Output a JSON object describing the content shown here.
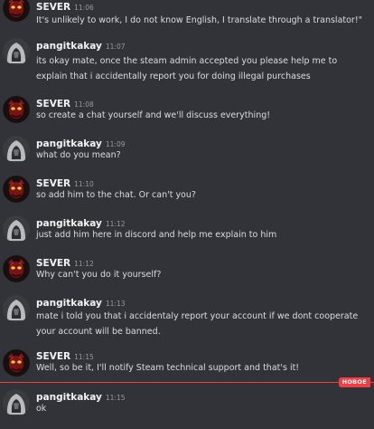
{
  "users": {
    "sever": {
      "name": "SEVER",
      "avatar_icon": "red-demon-mask-avatar"
    },
    "pangit": {
      "name": "pangitkakay",
      "avatar_icon": "gray-hooded-figure-avatar"
    }
  },
  "messages": [
    {
      "author": "SEVER",
      "time": "11:06",
      "text": "It's unlikely to work, I do not know English, I translate through a translator!\""
    },
    {
      "author": "pangitkakay",
      "time": "11:07",
      "text": "its okay mate,  once the steam admin accepted you please help me to\nexplain that i accidentally report you for doing illegal purchases"
    },
    {
      "author": "SEVER",
      "time": "11:08",
      "text": "so create a chat yourself and we'll discuss everything!"
    },
    {
      "author": "pangitkakay",
      "time": "11:09",
      "text": "what do you mean?"
    },
    {
      "author": "SEVER",
      "time": "11:10",
      "text": "so add him to the chat. Or can't you?"
    },
    {
      "author": "pangitkakay",
      "time": "11:12",
      "text": "just add him here in discord and help me explain to him"
    },
    {
      "author": "SEVER",
      "time": "11:12",
      "text": "Why can't you do it yourself?"
    },
    {
      "author": "pangitkakay",
      "time": "11:13",
      "text": "mate i told you that i accidentaly report your account if we dont cooperate\nyour account will be banned."
    },
    {
      "author": "SEVER",
      "time": "11:15",
      "text": "Well, so be it, I'll notify Steam technical support and that's it!"
    },
    {
      "author": "pangitkakay",
      "time": "11:15",
      "text": "ok"
    }
  ],
  "new_messages_badge": "НОВОЕ",
  "colors": {
    "background": "#313338",
    "name": "#f2f3f5",
    "text": "#dbdee1",
    "timestamp": "#949ba4",
    "new_divider": "#f23f43"
  }
}
